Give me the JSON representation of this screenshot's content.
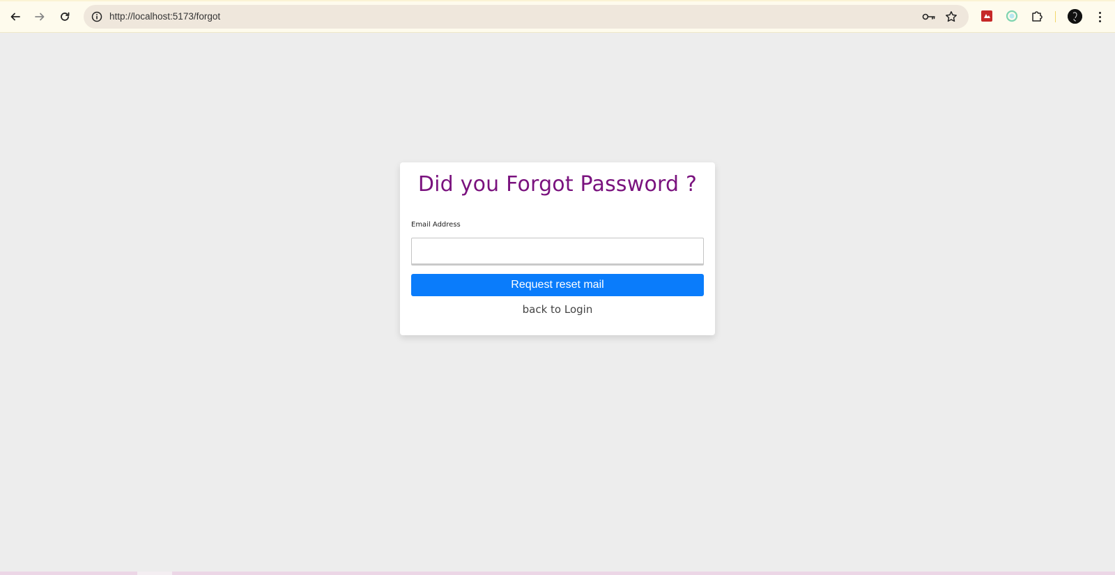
{
  "browser": {
    "url": "http://localhost:5173/forgot",
    "icons": {
      "back": "arrow-left-icon",
      "forward": "arrow-right-icon",
      "reload": "reload-icon",
      "site_info": "info-icon",
      "password_key": "key-icon",
      "bookmark": "star-icon",
      "extension_1": "red-extension-icon",
      "extension_2": "green-circle-extension-icon",
      "extensions_menu": "puzzle-icon",
      "profile": "avatar-icon",
      "menu": "kebab-menu-icon"
    }
  },
  "form": {
    "title": "Did you Forgot Password ?",
    "email_label": "Email Address",
    "email_value": "",
    "submit_label": "Request reset mail",
    "back_link": "back to Login"
  },
  "colors": {
    "page_background": "#ededed",
    "title": "#7a127e",
    "button": "#0a7cfb",
    "toolbar": "#fefbed"
  }
}
